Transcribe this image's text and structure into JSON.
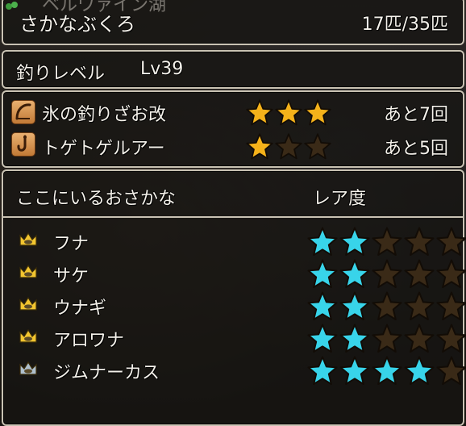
{
  "header": {
    "background_caption": "ベルワァイン湖",
    "title": "さかなぶくろ",
    "count": "17匹/35匹"
  },
  "fishing_level": {
    "label": "釣りレベル",
    "level": "Lv39"
  },
  "tools": [
    {
      "name": "氷の釣りざお改",
      "icon": "fishing-rod-icon",
      "stars": 3,
      "max_stars": 3,
      "remaining": "あと7回"
    },
    {
      "name": "トゲトゲルアー",
      "icon": "lure-hook-icon",
      "stars": 1,
      "max_stars": 3,
      "remaining": "あと5回"
    }
  ],
  "fish_list": {
    "header": "ここにいるおさかな",
    "rarity_header": "レア度",
    "items": [
      {
        "name": "フナ",
        "crown": "gold-crown-icon",
        "rarity": 2,
        "max": 5
      },
      {
        "name": "サケ",
        "crown": "gold-crown-icon",
        "rarity": 2,
        "max": 5
      },
      {
        "name": "ウナギ",
        "crown": "gold-crown-icon",
        "rarity": 2,
        "max": 5
      },
      {
        "name": "アロワナ",
        "crown": "gold-crown-icon",
        "rarity": 2,
        "max": 5
      },
      {
        "name": "ジムナーカス",
        "crown": "silver-crown-icon",
        "rarity": 4,
        "max": 5
      }
    ]
  },
  "colors": {
    "gold_star": "#f5b21a",
    "cyan_star": "#38d4ea",
    "empty_star": "#3a2a17",
    "panel_border": "#c9c2b3",
    "gold_crown": "#f2c530",
    "silver_crown": "#aebfcc"
  }
}
